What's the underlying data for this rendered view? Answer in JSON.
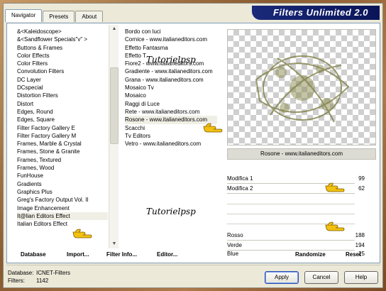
{
  "header": {
    "tabs": [
      {
        "label": "Navigator",
        "active": true
      },
      {
        "label": "Presets",
        "active": false
      },
      {
        "label": "About",
        "active": false
      }
    ],
    "banner": "Filters Unlimited 2.0"
  },
  "categories": [
    "&<Kaleidoscope>",
    "&<Sandflower Specials\"v\" >",
    "Buttons & Frames",
    "Color Effects",
    "Color Filters",
    "Convolution Filters",
    "DC Layer",
    "DCspecial",
    "Distortion Filters",
    "Distort",
    "Edges, Round",
    "Edges, Square",
    "Filter Factory Gallery E",
    "Filter Factory Gallery M",
    "Frames, Marble & Crystal",
    "Frames, Stone & Granite",
    "Frames, Textured",
    "Frames, Wood",
    "FunHouse",
    "Gradients",
    "Graphics Plus",
    "Greg's Factory Output Vol. II",
    "Image Enhancement",
    "It@lian Editors Effect",
    "Italian Editors Effect"
  ],
  "filters": [
    "Bordo con luci",
    "Cornice - www.italianeditors.com",
    "Effetto Fantasma",
    "Effetto T",
    "Fiore2 - www.italianeditors.com",
    "Gradiente - www.italianeditors.com",
    "Grana - www.italianeditors.com",
    "Mosaico Tv",
    "Mosaico",
    "Raggi di Luce",
    "Rete - www.italianeditors.com",
    "Rosone - www.italianeditors.com",
    "Scacchi",
    "Tv Editors",
    "Vetro - www.italianeditors.com"
  ],
  "watermark": "Tutorielpsp",
  "preview_name": "Rosone - www.italianeditors.com",
  "sliders": [
    {
      "label": "Modifica 1",
      "value": "99"
    },
    {
      "label": "Modifica 2",
      "value": "62"
    },
    {
      "label": "Rosso",
      "value": "188"
    },
    {
      "label": "Verde",
      "value": "194"
    },
    {
      "label": "Blue",
      "value": "25"
    }
  ],
  "buttons": {
    "database": "Database",
    "import": "Import...",
    "filter_info": "Filter Info...",
    "editor": "Editor...",
    "randomize": "Randomize",
    "reset": "Reset",
    "apply": "Apply",
    "cancel": "Cancel",
    "help": "Help"
  },
  "info": {
    "database_label": "Database:",
    "database_value": "ICNET-Filters",
    "filters_label": "Filters:",
    "filters_value": "1142"
  },
  "colors": {
    "accent": "#0a1458",
    "hand": "#f2c010"
  }
}
